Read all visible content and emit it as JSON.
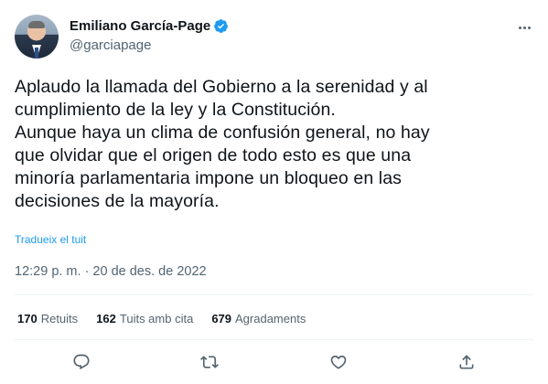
{
  "author": {
    "name": "Emiliano García-Page",
    "handle": "@garciapage",
    "verified": true
  },
  "tweet": {
    "text": "Aplaudo la llamada del Gobierno a la serenidad y al\ncumplimiento de la ley y la Constitución.\nAunque haya un clima de confusión general, no hay\nque olvidar que el origen de todo esto es que una\nminoría parlamentaria impone un bloqueo en las\ndecisiones de la mayoría.",
    "translate_label": "Tradueix el tuit",
    "timestamp": "12:29 p. m. · 20 de des. de 2022"
  },
  "stats": {
    "retweets_count": "170",
    "retweets_label": "Retuits",
    "quotes_count": "162",
    "quotes_label": "Tuits amb cita",
    "likes_count": "679",
    "likes_label": "Agradaments"
  },
  "actions": [
    "reply-icon",
    "retweet-icon",
    "like-icon",
    "share-icon"
  ],
  "colors": {
    "accent": "#1d9bf0",
    "text": "#0f1419",
    "secondary": "#536471"
  }
}
